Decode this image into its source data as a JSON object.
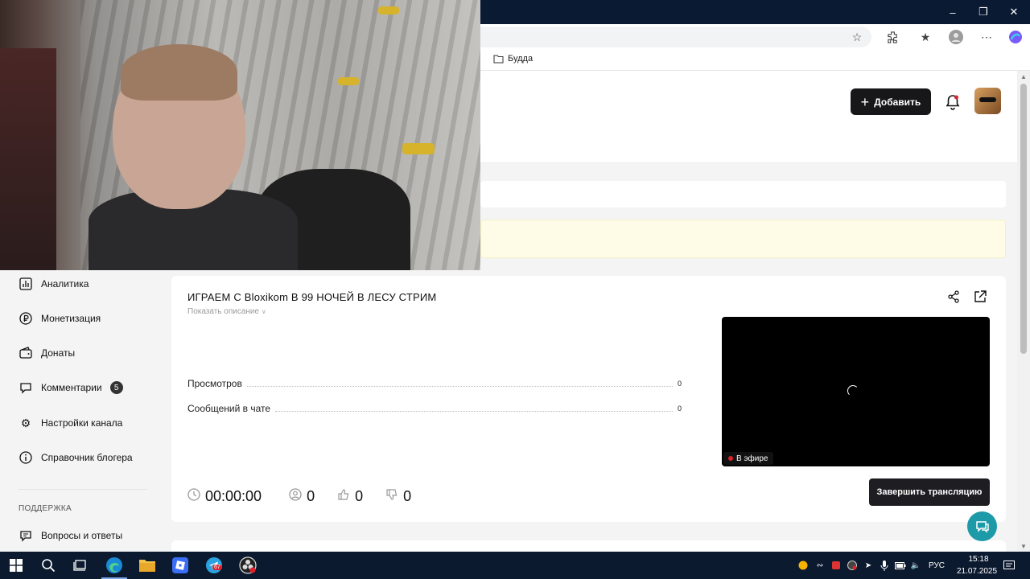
{
  "bookmarks": {
    "folder_label": "Будда"
  },
  "header": {
    "add_label": "Добавить"
  },
  "sidebar": {
    "items": [
      {
        "label": "Аналитика",
        "icon": "chart-icon"
      },
      {
        "label": "Монетизация",
        "icon": "ruble-icon"
      },
      {
        "label": "Донаты",
        "icon": "wallet-icon"
      },
      {
        "label": "Комментарии",
        "icon": "comment-icon",
        "badge": "5"
      },
      {
        "label": "Настройки канала",
        "icon": "gear-icon"
      },
      {
        "label": "Справочник блогера",
        "icon": "info-icon"
      }
    ],
    "section_title": "ПОДДЕРЖКА",
    "support_items": [
      {
        "label": "Вопросы и ответы",
        "icon": "chat-icon"
      }
    ]
  },
  "stream": {
    "title": "ИГРАЕМ С Bloxikom В 99 НОЧЕЙ В ЛЕСУ СТРИМ",
    "show_description": "Показать описание",
    "stats": [
      {
        "label": "Просмотров",
        "value": "0"
      },
      {
        "label": "Сообщений в чате",
        "value": "0"
      }
    ],
    "live_label": "В эфире",
    "end_label": "Завершить трансляцию",
    "timer": "00:00:00",
    "viewers": "0",
    "likes": "0",
    "dislikes": "0"
  },
  "taskbar": {
    "lang": "РУС",
    "time": "15:18",
    "date": "21.07.2025",
    "telegram_badge": "67"
  }
}
